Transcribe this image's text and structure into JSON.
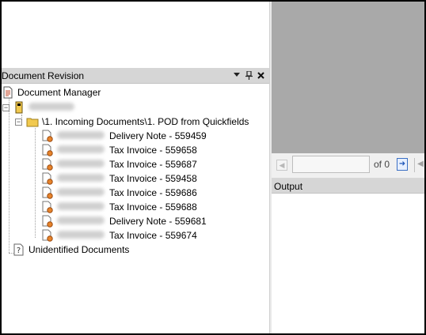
{
  "left_pane": {
    "title": "Document Revision",
    "buttons": {
      "dropdown": "▾",
      "pin": "ᵖ",
      "close": "✕"
    }
  },
  "tree": {
    "root_label": "Document Manager",
    "folder_path": "\\1. Incoming Documents\\1. POD from Quickfields",
    "documents": [
      {
        "label": "Delivery Note - 559459"
      },
      {
        "label": "Tax Invoice - 559658"
      },
      {
        "label": "Tax Invoice - 559687"
      },
      {
        "label": "Tax Invoice - 559458"
      },
      {
        "label": "Tax Invoice - 559686"
      },
      {
        "label": "Tax Invoice - 559688"
      },
      {
        "label": "Delivery Note - 559681"
      },
      {
        "label": "Tax Invoice - 559674"
      }
    ],
    "unidentified_label": "Unidentified Documents"
  },
  "viewer": {
    "page_value": "",
    "of_text": "of 0"
  },
  "output": {
    "title": "Output"
  },
  "colors": {
    "header_bg": "#d6d6d6",
    "preview_bg": "#a9a9a9",
    "folder_yellow": "#f1c94e",
    "doc_orange": "#e7842b",
    "nav_blue": "#1f57b8"
  }
}
